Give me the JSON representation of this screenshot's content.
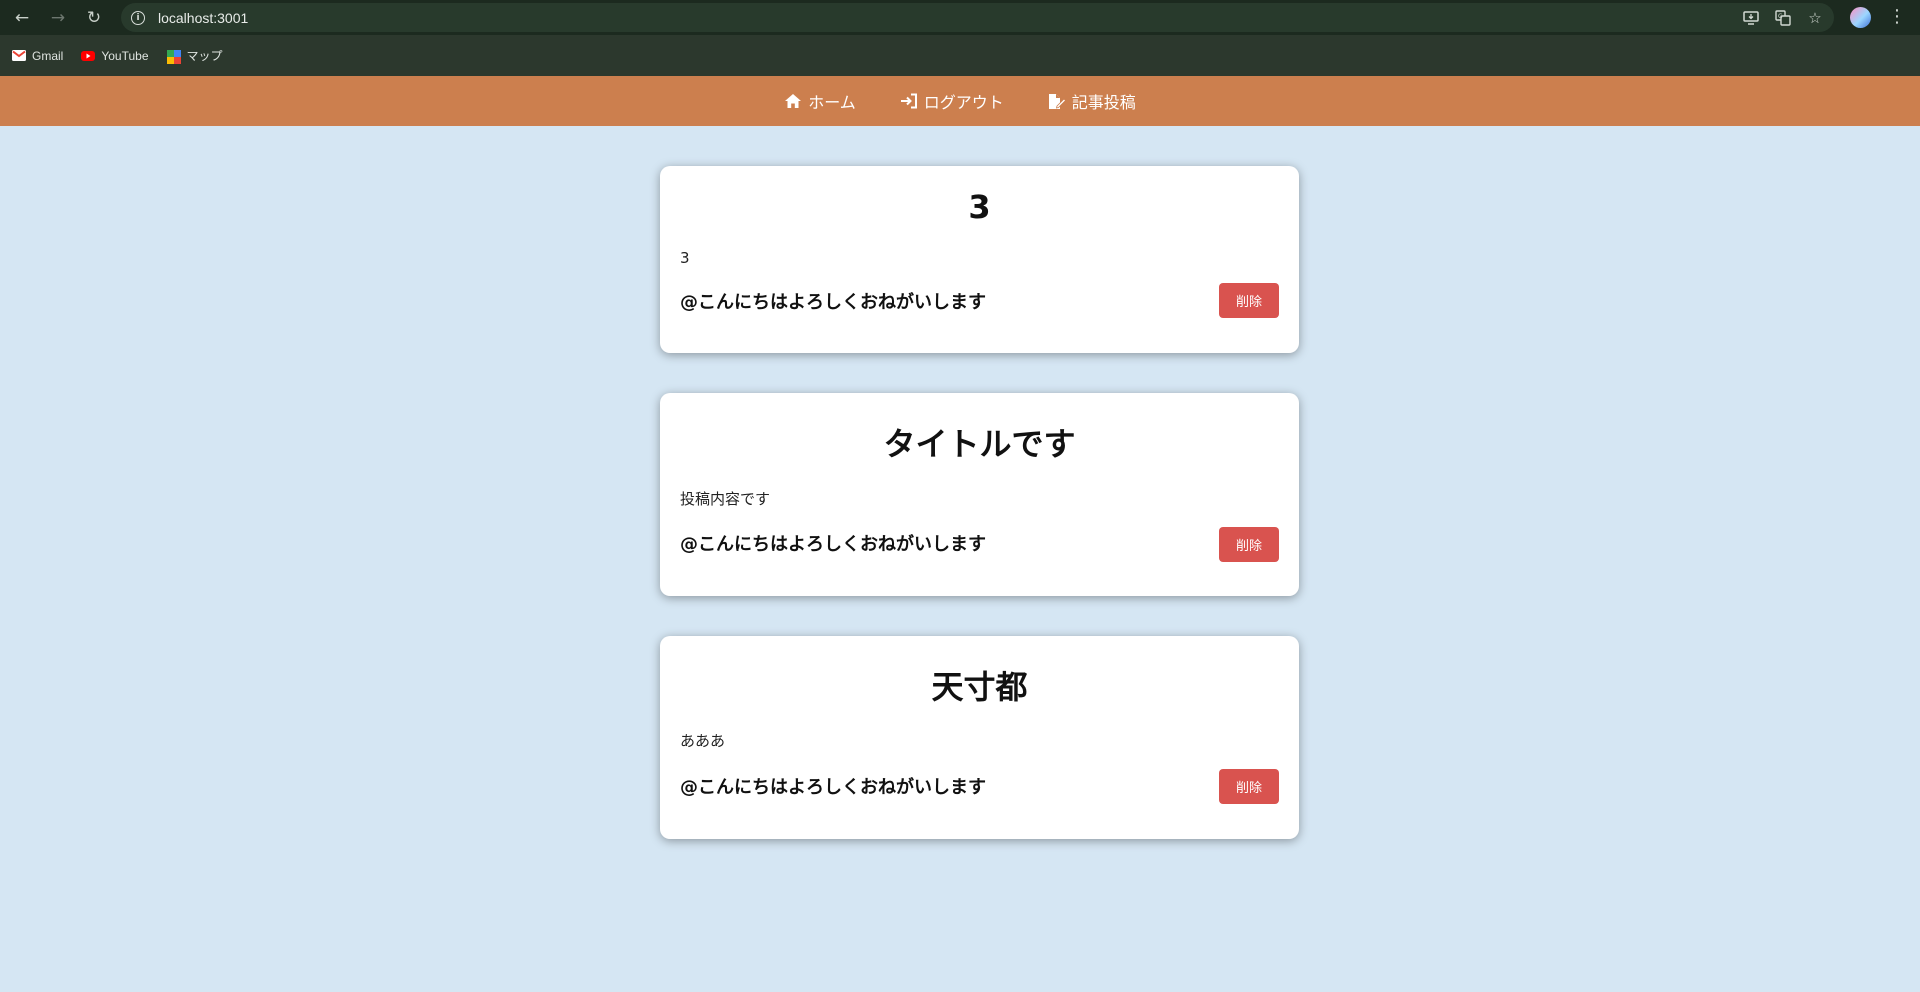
{
  "browser": {
    "url": "localhost:3001",
    "bookmarks": [
      {
        "label": "Gmail",
        "icon": "gmail-icon"
      },
      {
        "label": "YouTube",
        "icon": "youtube-icon"
      },
      {
        "label": "マップ",
        "icon": "maps-icon"
      }
    ]
  },
  "header": {
    "accent": "#cc7f4e",
    "nav": [
      {
        "label": "ホーム",
        "icon": "home-icon"
      },
      {
        "label": "ログアウト",
        "icon": "logout-icon"
      },
      {
        "label": "記事投稿",
        "icon": "post-article-icon"
      }
    ]
  },
  "posts": [
    {
      "title": "3",
      "body": "3",
      "author": "@こんにちはよろしくおねがいします",
      "delete_label": "削除"
    },
    {
      "title": "タイトルです",
      "body": "投稿内容です",
      "author": "@こんにちはよろしくおねがいします",
      "delete_label": "削除"
    },
    {
      "title": "天寸都",
      "body": "あああ",
      "author": "@こんにちはよろしくおねがいします",
      "delete_label": "削除"
    }
  ],
  "colors": {
    "background": "#d5e6f3",
    "delete_button": "#d9534f"
  }
}
